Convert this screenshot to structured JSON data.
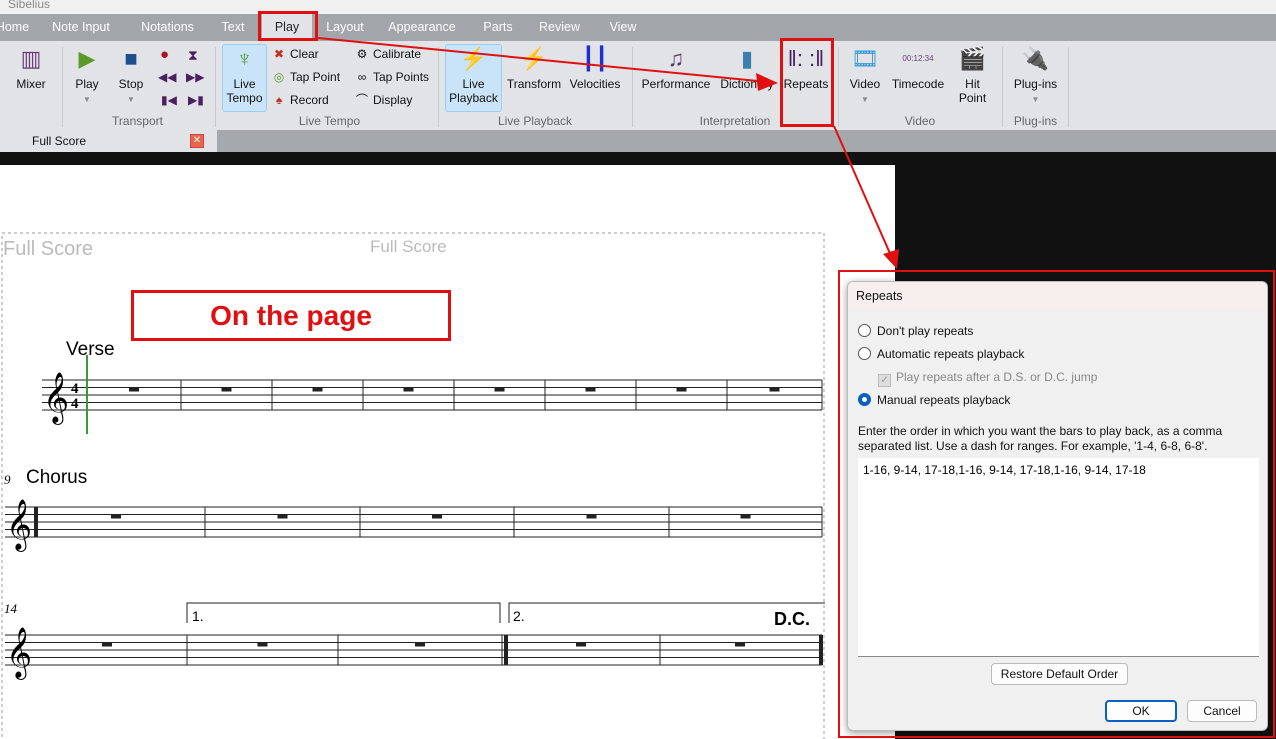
{
  "app": {
    "title": "Sibelius"
  },
  "tabs": [
    {
      "label": "Home"
    },
    {
      "label": "Note Input"
    },
    {
      "label": "Notations"
    },
    {
      "label": "Text"
    },
    {
      "label": "Play",
      "active": true
    },
    {
      "label": "Layout"
    },
    {
      "label": "Appearance"
    },
    {
      "label": "Parts"
    },
    {
      "label": "Review"
    },
    {
      "label": "View"
    }
  ],
  "ribbon": {
    "mixer": "Mixer",
    "play": "Play",
    "stop": "Stop",
    "transport": "Transport",
    "live_tempo": "Live Tempo",
    "clear": "Clear",
    "tap_point": "Tap Point",
    "record": "Record",
    "calibrate": "Calibrate",
    "tap_points": "Tap Points",
    "display": "Display",
    "live_tempo_group": "Live Tempo",
    "live_playback": "Live Playback",
    "transform": "Transform",
    "velocities": "Velocities",
    "live_playback_group": "Live Playback",
    "performance": "Performance",
    "dictionary": "Dictionary",
    "repeats": "Repeats",
    "interpretation_group": "Interpretation",
    "video": "Video",
    "timecode": "Timecode",
    "timecode_display": "00:12:34",
    "hit_point": "Hit Point",
    "video_group": "Video",
    "plugins": "Plug-ins",
    "plugins_group": "Plug-ins"
  },
  "document_tab": {
    "label": "Full Score"
  },
  "score": {
    "header_left": "Full Score",
    "header_center": "Full Score",
    "verse": "Verse",
    "chorus": "Chorus",
    "bar_9": "9",
    "bar_14": "14",
    "ending_1": "1.",
    "ending_2": "2.",
    "dc": "D.C.",
    "time_sig_top": "4",
    "time_sig_bottom": "4"
  },
  "annotation": {
    "label": "On the page",
    "color": "#e01010"
  },
  "dialog": {
    "title": "Repeats",
    "options": [
      {
        "label": "Don't play repeats",
        "selected": false
      },
      {
        "label": "Automatic repeats playback",
        "selected": false
      },
      {
        "label": "Manual repeats playback",
        "selected": true
      }
    ],
    "checkbox": {
      "label": "Play repeats after a D.S. or D.C. jump",
      "checked": true,
      "disabled": true
    },
    "instructions": "Enter the order in which you want the bars to play back, as a comma separated list. Use a dash for ranges. For example, '1-4, 6-8, 6-8'.",
    "order_value": "1-16, 9-14, 17-18,1-16, 9-14, 17-18,1-16, 9-14, 17-18",
    "restore": "Restore Default Order",
    "ok": "OK",
    "cancel": "Cancel"
  }
}
